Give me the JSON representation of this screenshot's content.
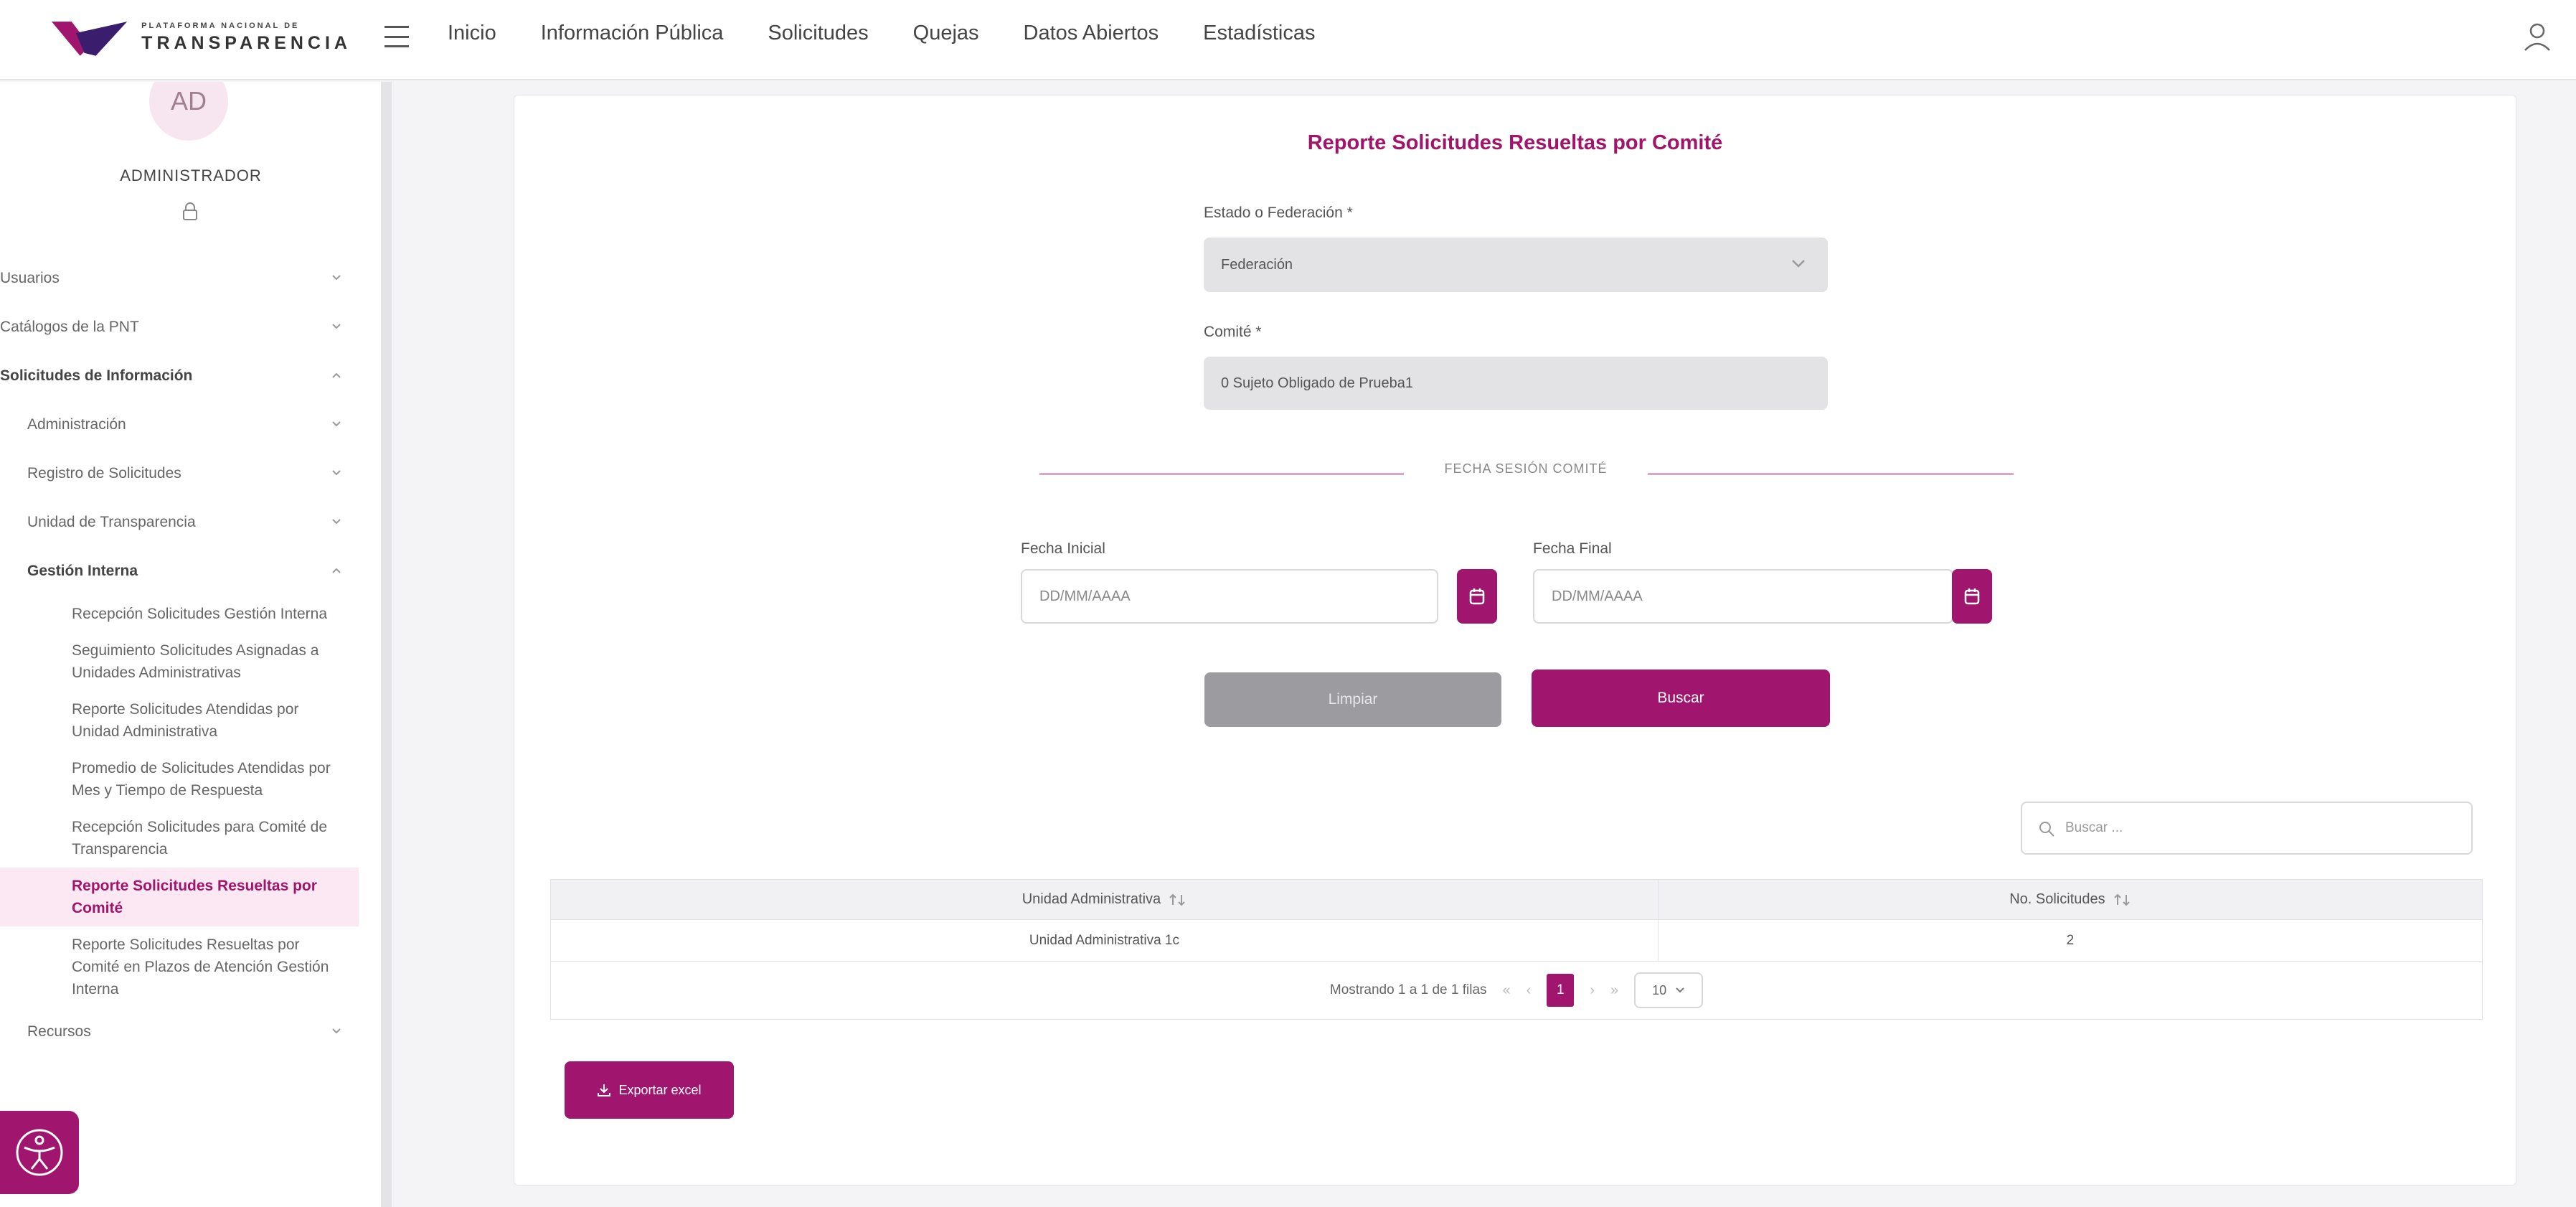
{
  "header": {
    "logo_small": "PLATAFORMA NACIONAL DE",
    "logo_big": "TRANSPARENCIA",
    "nav": [
      "Inicio",
      "Información Pública",
      "Solicitudes",
      "Quejas",
      "Datos Abiertos",
      "Estadísticas"
    ]
  },
  "sidebar": {
    "avatar": "AD",
    "user_name": "ADMINISTRADOR",
    "items": [
      {
        "label": "Usuarios"
      },
      {
        "label": "Catálogos de la PNT"
      },
      {
        "label": "Solicitudes de Información"
      },
      {
        "label": "Administración"
      },
      {
        "label": "Registro de Solicitudes"
      },
      {
        "label": "Unidad de Transparencia"
      },
      {
        "label": "Gestión Interna"
      },
      {
        "label": "Recepción Solicitudes Gestión Interna"
      },
      {
        "label": "Seguimiento Solicitudes Asignadas a Unidades Administrativas"
      },
      {
        "label": "Reporte Solicitudes Atendidas por Unidad Administrativa"
      },
      {
        "label": "Promedio de Solicitudes Atendidas por Mes y Tiempo de Respuesta"
      },
      {
        "label": "Recepción Solicitudes para Comité de Transparencia"
      },
      {
        "label": "Reporte Solicitudes Resueltas por Comité"
      },
      {
        "label": "Reporte Solicitudes Resueltas por Comité en Plazos de Atención Gestión Interna"
      },
      {
        "label": "Recursos"
      }
    ]
  },
  "main": {
    "title": "Reporte Solicitudes Resueltas por Comité",
    "estado_label": "Estado o Federación *",
    "estado_value": "Federación",
    "comite_label": "Comité *",
    "comite_value": "0 Sujeto Obligado de Prueba1",
    "section_label": "FECHA SESIÓN COMITÉ",
    "fecha_inicial_label": "Fecha Inicial",
    "fecha_inicial_placeholder": "DD/MM/AAAA",
    "fecha_final_label": "Fecha Final",
    "fecha_final_placeholder": "DD/MM/AAAA",
    "clear_label": "Limpiar",
    "search_label": "Buscar",
    "table_search_placeholder": "Buscar ...",
    "table": {
      "columns": [
        "Unidad Administrativa",
        "No. Solicitudes"
      ],
      "rows": [
        [
          "Unidad Administrativa 1c",
          "2"
        ]
      ]
    },
    "pagination": {
      "summary": "Mostrando 1 a 1 de 1 filas",
      "first": "«",
      "prev": "‹",
      "current": "1",
      "next": "›",
      "last": "»",
      "page_size": "10"
    },
    "export_label": "Exportar excel"
  },
  "colors": {
    "brand": "#a0166e",
    "disabled": "#9c9ca0",
    "input_readonly": "#e3e3e6"
  }
}
